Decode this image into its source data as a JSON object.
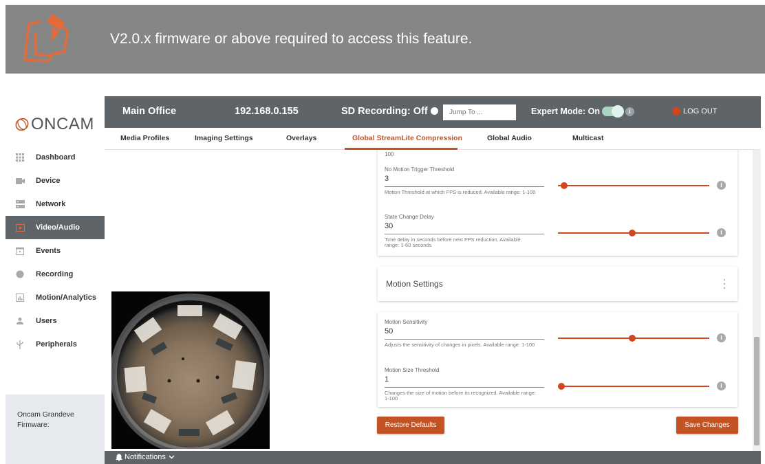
{
  "banner": {
    "text": "V2.0.x firmware or above required to access this feature."
  },
  "brand": {
    "logo_text": "ONCAM"
  },
  "sidebar": {
    "items": [
      {
        "label": "Dashboard",
        "icon": "grid-icon"
      },
      {
        "label": "Device",
        "icon": "camera-icon"
      },
      {
        "label": "Network",
        "icon": "network-icon"
      },
      {
        "label": "Video/Audio",
        "icon": "play-icon",
        "active": true
      },
      {
        "label": "Events",
        "icon": "calendar-icon"
      },
      {
        "label": "Recording",
        "icon": "record-icon"
      },
      {
        "label": "Motion/Analytics",
        "icon": "chart-icon"
      },
      {
        "label": "Users",
        "icon": "user-icon"
      },
      {
        "label": "Peripherals",
        "icon": "usb-icon"
      }
    ],
    "footer": {
      "model": "Oncam Grandeve",
      "firmware_label": "Firmware:"
    }
  },
  "header": {
    "site": "Main Office",
    "ip": "192.168.0.155",
    "sd_recording": "SD Recording: Off",
    "jump_placeholder": "Jump To ...",
    "expert_mode": "Expert Mode: On",
    "logout": "LOG OUT"
  },
  "tabs": [
    {
      "label": "Media Profiles"
    },
    {
      "label": "Imaging Settings"
    },
    {
      "label": "Overlays"
    },
    {
      "label": "Global StreamLite Compression",
      "active": true
    },
    {
      "label": "Global Audio"
    },
    {
      "label": "Multicast"
    }
  ],
  "settings": {
    "partial_value": "100",
    "no_motion": {
      "label": "No Motion Trigger Threshold",
      "value": "3",
      "help": "Motion Threshold at which FPS is reduced. Available range: 1-100",
      "slider_fraction": 0.02
    },
    "state_change": {
      "label": "State Change Delay",
      "value": "30",
      "help": "Time delay in seconds before next FPS reduction. Available range: 1-60 seconds",
      "slider_fraction": 0.49
    },
    "motion_settings_title": "Motion Settings",
    "motion_sensitivity": {
      "label": "Motion Sensitivity",
      "value": "50",
      "help": "Adjusts the sensitivity of changes in pixels. Available range: 1-100",
      "slider_fraction": 0.49
    },
    "motion_size": {
      "label": "Motion Size Threshold",
      "value": "1",
      "help": "Changes the size of motion before its recognized. Available range: 1-100",
      "slider_fraction": 0.0
    }
  },
  "buttons": {
    "restore": "Restore Defaults",
    "save": "Save Changes"
  },
  "footer": {
    "notifications": "Notifications"
  },
  "colors": {
    "accent": "#c45324",
    "header": "#5f6468",
    "banner": "#868686"
  }
}
